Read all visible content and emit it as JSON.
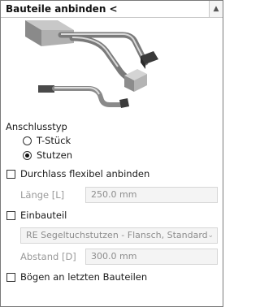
{
  "panel": {
    "title": "Bauteile anbinden <",
    "scroll_icon": "arrow-up-icon"
  },
  "connection_type": {
    "label": "Anschlusstyp",
    "options": [
      {
        "label": "T-Stück",
        "selected": false
      },
      {
        "label": "Stutzen",
        "selected": true
      }
    ]
  },
  "flex_duct": {
    "label": "Durchlass flexibel anbinden",
    "checked": false
  },
  "length": {
    "label": "Länge [L]",
    "value": "250.0 mm"
  },
  "fitting": {
    "label": "Einbauteil",
    "checked": false
  },
  "fitting_select": {
    "value": "RE Segeltuchstutzen - Flansch, Standard"
  },
  "distance": {
    "label": "Abstand [D]",
    "value": "300.0 mm"
  },
  "bends": {
    "label": "Bögen an letzten Bauteilen",
    "checked": false
  }
}
